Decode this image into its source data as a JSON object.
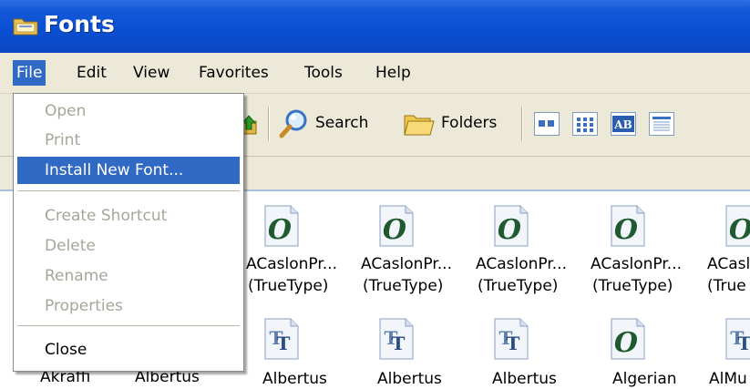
{
  "window": {
    "title": "Fonts"
  },
  "menubar": {
    "items": [
      {
        "label": "File"
      },
      {
        "label": "Edit"
      },
      {
        "label": "View"
      },
      {
        "label": "Favorites"
      },
      {
        "label": "Tools"
      },
      {
        "label": "Help"
      }
    ]
  },
  "toolbar": {
    "search_label": "Search",
    "folders_label": "Folders"
  },
  "file_menu": {
    "items": [
      {
        "label": "Open",
        "enabled": false
      },
      {
        "label": "Print",
        "enabled": false
      },
      {
        "label": "Install New Font...",
        "enabled": true,
        "highlighted": true
      },
      {
        "label": "Create Shortcut",
        "enabled": false
      },
      {
        "label": "Delete",
        "enabled": false
      },
      {
        "label": "Rename",
        "enabled": false
      },
      {
        "label": "Properties",
        "enabled": false
      },
      {
        "label": "Close",
        "enabled": true
      }
    ]
  },
  "fonts": {
    "row1": [
      {
        "name": "ACaslonPr...",
        "type": "(TrueType)",
        "icon": "opentype-font-icon"
      },
      {
        "name": "ACaslonPr...",
        "type": "(TrueType)",
        "icon": "opentype-font-icon"
      },
      {
        "name": "ACaslonPr...",
        "type": "(TrueType)",
        "icon": "opentype-font-icon"
      },
      {
        "name": "ACaslonPr...",
        "type": "(TrueType)",
        "icon": "opentype-font-icon"
      },
      {
        "name": "ACasl",
        "type": "(True",
        "icon": "opentype-font-icon"
      }
    ],
    "row2": [
      {
        "name": "Akraffi",
        "icon": "truetype-font-icon"
      },
      {
        "name": "Albertus",
        "icon": "truetype-font-icon"
      },
      {
        "name": "Albertus",
        "icon": "truetype-font-icon"
      },
      {
        "name": "Albertus",
        "icon": "truetype-font-icon"
      },
      {
        "name": "Albertus",
        "icon": "truetype-font-icon"
      },
      {
        "name": "Algerian",
        "icon": "opentype-font-icon"
      },
      {
        "name": "AlMu",
        "icon": "truetype-font-icon"
      }
    ]
  },
  "colors": {
    "titlebar": "#0a4fd3",
    "highlight": "#316ac5",
    "chrome": "#ece9d8",
    "disabled_text": "#a7a69a"
  }
}
